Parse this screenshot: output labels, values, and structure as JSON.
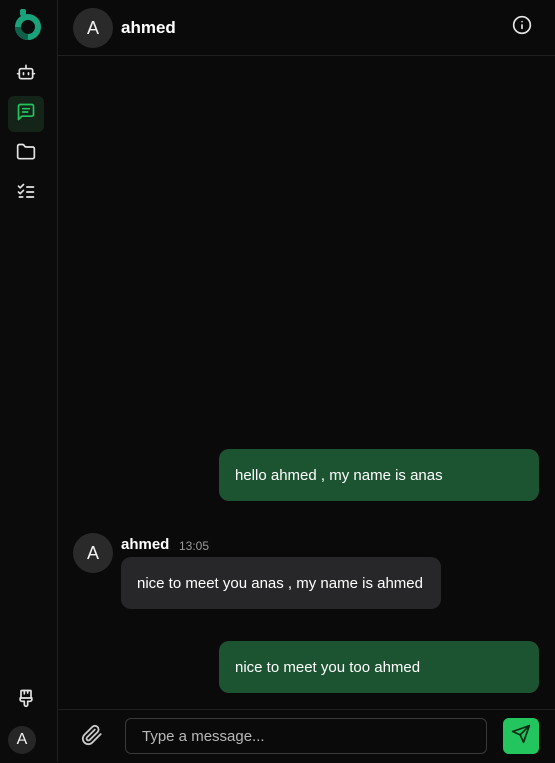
{
  "sidebar": {
    "logo_icon": "app-logo",
    "items": [
      {
        "icon": "bot-icon",
        "active": false
      },
      {
        "icon": "chat-icon",
        "active": true
      },
      {
        "icon": "folder-icon",
        "active": false
      },
      {
        "icon": "checklist-icon",
        "active": false
      }
    ],
    "bottom_icon": "brush-icon",
    "user_initial": "A"
  },
  "header": {
    "avatar_initial": "A",
    "name": "ahmed",
    "info_icon": "info-icon"
  },
  "messages": [
    {
      "direction": "sent",
      "text": "hello ahmed , my name is anas"
    },
    {
      "direction": "received",
      "sender": "ahmed",
      "avatar_initial": "A",
      "time": "13:05",
      "text": "nice to meet you anas , my name is ahmed"
    },
    {
      "direction": "sent",
      "text": "nice to meet you too ahmed"
    }
  ],
  "composer": {
    "placeholder": "Type a message...",
    "value": "",
    "attach_icon": "paperclip-icon",
    "send_icon": "send-icon"
  },
  "colors": {
    "accent": "#22c55e",
    "sent_bubble": "#1c5431",
    "received_bubble": "#272729",
    "background": "#0a0a0a"
  }
}
